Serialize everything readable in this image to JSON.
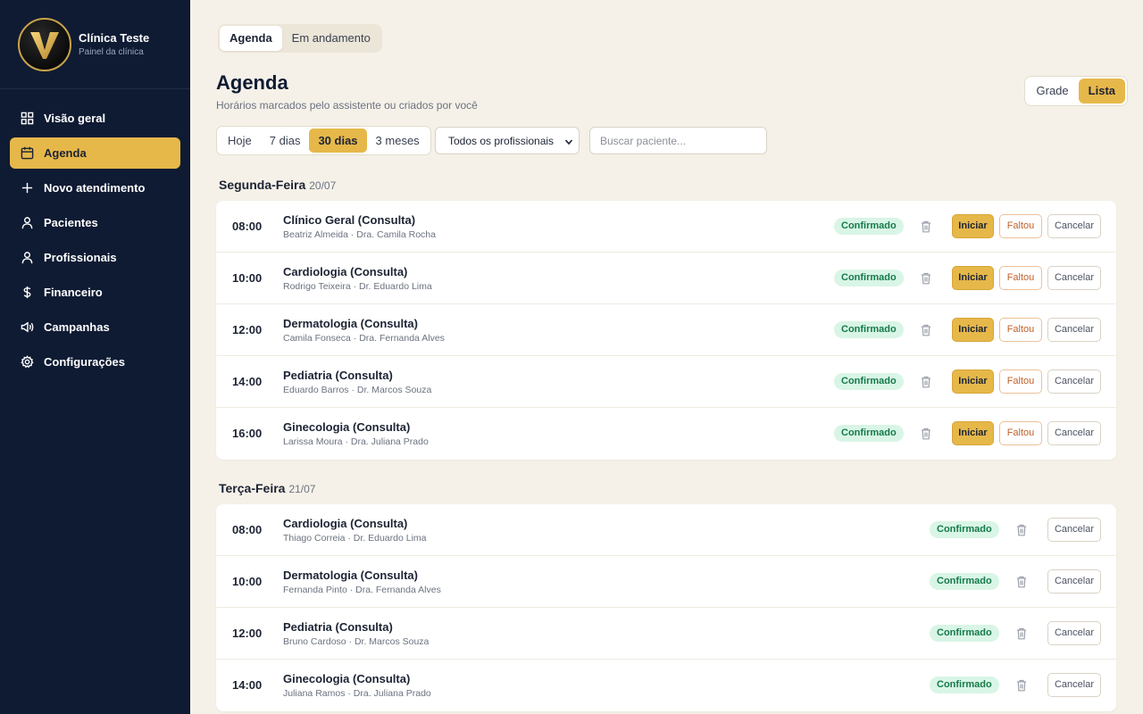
{
  "brand": {
    "name": "Clínica Teste",
    "subtitle": "Painel da clínica",
    "logo_letter": "V"
  },
  "sidebar": {
    "items": [
      {
        "label": "Visão geral",
        "icon": "grid-icon"
      },
      {
        "label": "Agenda",
        "icon": "calendar-icon",
        "active": true
      },
      {
        "label": "Novo atendimento",
        "icon": "plus-icon"
      },
      {
        "label": "Pacientes",
        "icon": "user-icon"
      },
      {
        "label": "Profissionais",
        "icon": "user-icon"
      },
      {
        "label": "Financeiro",
        "icon": "dollar-icon"
      },
      {
        "label": "Campanhas",
        "icon": "megaphone-icon"
      },
      {
        "label": "Configurações",
        "icon": "gear-icon"
      }
    ]
  },
  "tabs": [
    {
      "label": "Agenda",
      "active": true
    },
    {
      "label": "Em andamento",
      "active": false
    }
  ],
  "header": {
    "title": "Agenda",
    "subtitle": "Horários marcados pelo assistente ou criados por você"
  },
  "view_toggle": {
    "grade": "Grade",
    "lista": "Lista",
    "selected": "Lista"
  },
  "range": {
    "options": [
      "Hoje",
      "7 dias",
      "30 dias",
      "3 meses"
    ],
    "selected": "30 dias"
  },
  "professional_filter": {
    "value": "Todos os profissionais"
  },
  "search": {
    "placeholder": "Buscar paciente..."
  },
  "actions": {
    "iniciar": "Iniciar",
    "faltou": "Faltou",
    "cancelar": "Cancelar"
  },
  "status_label": "Confirmado",
  "days": [
    {
      "weekday": "Segunda-Feira",
      "date": "20/07",
      "appointments": [
        {
          "time": "08:00",
          "title": "Clínico Geral (Consulta)",
          "patient": "Beatriz Almeida",
          "doctor": "Dra. Camila Rocha",
          "meta": "Beatriz Almeida · Dra. Camila Rocha"
        },
        {
          "time": "10:00",
          "title": "Cardiologia (Consulta)",
          "patient": "Rodrigo Teixeira",
          "doctor": "Dr. Eduardo Lima",
          "meta": "Rodrigo Teixeira · Dr. Eduardo Lima"
        },
        {
          "time": "12:00",
          "title": "Dermatologia (Consulta)",
          "patient": "Camila Fonseca",
          "doctor": "Dra. Fernanda Alves",
          "meta": "Camila Fonseca · Dra. Fernanda Alves"
        },
        {
          "time": "14:00",
          "title": "Pediatria (Consulta)",
          "patient": "Eduardo Barros",
          "doctor": "Dr. Marcos Souza",
          "meta": "Eduardo Barros · Dr. Marcos Souza"
        },
        {
          "time": "16:00",
          "title": "Ginecologia (Consulta)",
          "patient": "Larissa Moura",
          "doctor": "Dra. Juliana Prado",
          "meta": "Larissa Moura · Dra. Juliana Prado"
        }
      ]
    },
    {
      "weekday": "Terça-Feira",
      "date": "21/07",
      "appointments": [
        {
          "time": "08:00",
          "title": "Cardiologia (Consulta)",
          "patient": "Thiago Correia",
          "doctor": "Dr. Eduardo Lima",
          "meta": "Thiago Correia · Dr. Eduardo Lima"
        },
        {
          "time": "10:00",
          "title": "Dermatologia (Consulta)",
          "patient": "Fernanda Pinto",
          "doctor": "Dra. Fernanda Alves",
          "meta": "Fernanda Pinto · Dra. Fernanda Alves"
        },
        {
          "time": "12:00",
          "title": "Pediatria (Consulta)",
          "patient": "Bruno Cardoso",
          "doctor": "Dr. Marcos Souza",
          "meta": "Bruno Cardoso · Dr. Marcos Souza"
        },
        {
          "time": "14:00",
          "title": "Ginecologia (Consulta)",
          "patient": "Juliana Ramos",
          "doctor": "Dra. Juliana Prado",
          "meta": "Juliana Ramos · Dra. Juliana Prado"
        }
      ]
    }
  ],
  "colors": {
    "accent": "#e6b84a",
    "sidebar_bg": "#0f1b33",
    "page_bg": "#f5f1e8",
    "badge_bg": "#d9f5e6",
    "badge_text": "#157a4a",
    "faltou": "#c0622b"
  }
}
